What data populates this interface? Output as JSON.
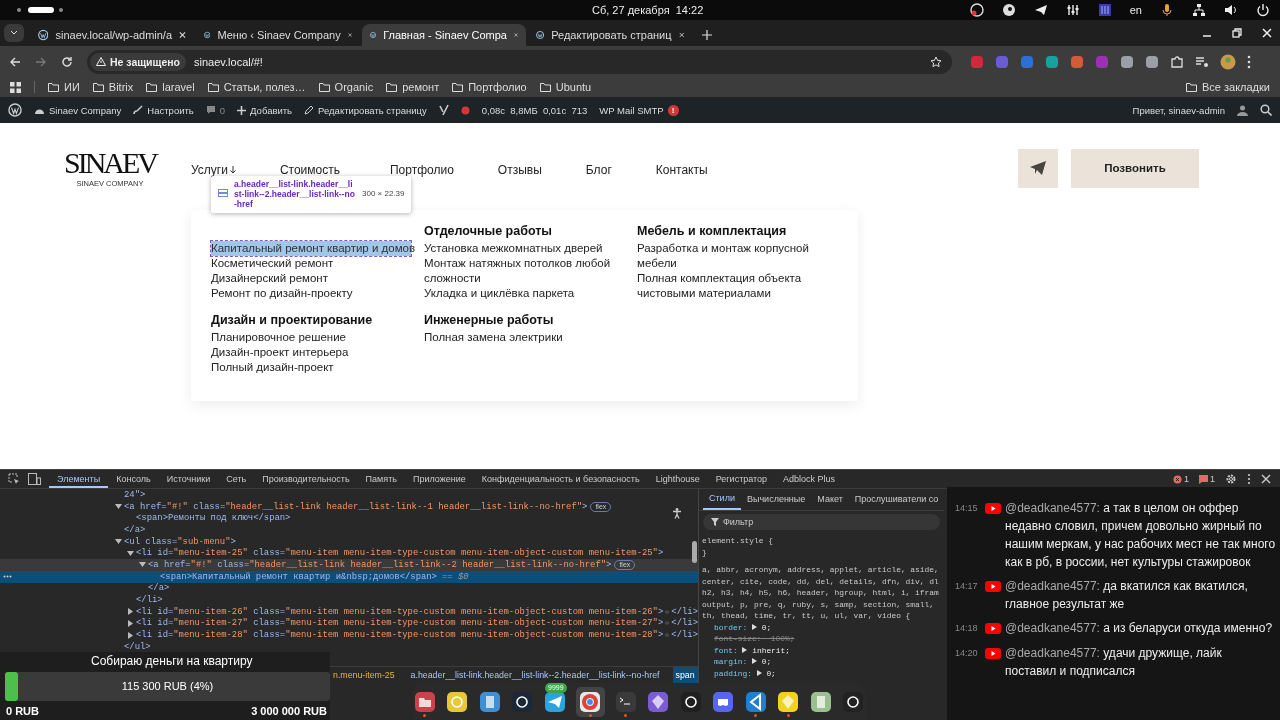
{
  "system_bar": {
    "datetime": "Сб, 27 декабря  14:22",
    "language": "en"
  },
  "browser": {
    "tabs": [
      {
        "title": "sinaev.local/wp-admin/a",
        "selected": false
      },
      {
        "title": "Меню ‹ Sinaev Company",
        "selected": false
      },
      {
        "title": "Главная - Sinaev Compa",
        "selected": true
      },
      {
        "title": "Редактировать страниц",
        "selected": false
      }
    ],
    "security_label": "Не защищено",
    "url": "sinaev.local/#!",
    "bookmarks": [
      "ИИ",
      "Bitrix",
      "laravel",
      "Статьи, полез…",
      "Organic",
      "ремонт",
      "Портфолио",
      "Ubuntu"
    ],
    "all_bookmarks": "Все закладки"
  },
  "admin_bar": {
    "site": "Sinaev Company",
    "customize": "Настроить",
    "comments": "0",
    "add": "Добавить",
    "edit": "Редактировать страницу",
    "stats": "0,08с  8,8МБ  0,01с  713",
    "smtp": "WP Mail SMTP",
    "smtp_alert": "!",
    "greeting": "Привет, sinaev-admin"
  },
  "site": {
    "logo": "SINAEV",
    "logo_caption": "SINAEV COMPANY",
    "nav": [
      {
        "label": "Услуги",
        "dropdown": true
      },
      {
        "label": "Стоимость",
        "dropdown": false
      },
      {
        "label": "Портфолио",
        "dropdown": false
      },
      {
        "label": "Отзывы",
        "dropdown": false
      },
      {
        "label": "Блог",
        "dropdown": false
      },
      {
        "label": "Контакты",
        "dropdown": false
      }
    ],
    "call_button": "Позвонить",
    "mega_menu": [
      {
        "items": [
          {
            "label": "Капитальный ремонт квартир и домов",
            "highlighted": true
          },
          {
            "label": "Косметический ремонт",
            "highlighted": false
          },
          {
            "label": "Дизайнерский ремонт",
            "highlighted": false
          },
          {
            "label": "Ремонт по дизайн-проекту",
            "highlighted": false
          }
        ]
      },
      {
        "title": "Отделочные работы",
        "items": [
          {
            "label": "Установка межкомнатных дверей",
            "highlighted": false
          },
          {
            "label": "Монтаж натяжных потолков любой сложности",
            "highlighted": false
          },
          {
            "label": "Укладка и циклёвка паркета",
            "highlighted": false
          }
        ]
      },
      {
        "title": "Мебель и комплектация",
        "items": [
          {
            "label": "Разработка и монтаж корпусной мебели",
            "highlighted": false
          },
          {
            "label": "Полная комплектация объекта чистовыми материалами",
            "highlighted": false
          }
        ]
      },
      {
        "title": "Дизайн и проектирование",
        "items": [
          {
            "label": "Планировочное решение",
            "highlighted": false
          },
          {
            "label": "Дизайн-проект интерьера",
            "highlighted": false
          },
          {
            "label": "Полный дизайн-проект",
            "highlighted": false
          }
        ]
      },
      {
        "title": "Инженерные работы",
        "items": [
          {
            "label": "Полная замена электрики",
            "highlighted": false
          }
        ]
      }
    ],
    "inspector_tooltip": {
      "selector": "a.header__list-link.header__list-link--2.header__list-link--no-href",
      "size": "300 × 22.39"
    }
  },
  "devtools": {
    "tabs": [
      {
        "label": "Элементы",
        "selected": true
      },
      {
        "label": "Консоль",
        "selected": false
      },
      {
        "label": "Источники",
        "selected": false
      },
      {
        "label": "Сеть",
        "selected": false
      },
      {
        "label": "Производительность",
        "selected": false
      },
      {
        "label": "Память",
        "selected": false
      },
      {
        "label": "Приложение",
        "selected": false
      },
      {
        "label": "Конфиденциальность и безопасность",
        "selected": false
      },
      {
        "label": "Lighthouse",
        "selected": false
      },
      {
        "label": "Регистратор",
        "selected": false
      },
      {
        "label": "Adblock Plus",
        "selected": false
      }
    ],
    "errors": "1",
    "issues": "1",
    "tree": [
      {
        "text": "24\">",
        "selected": false,
        "hovered": false
      },
      {
        "text": "<a href=\"#!\" class=\"header__list-link header__list-link--1 header__list-link--no-href\">",
        "badge": "flex",
        "expanded": true,
        "selected": false,
        "hovered": false,
        "close": "</a>",
        "children": [
          {
            "text": "<span>Ремонты под ключ</span>",
            "selected": false,
            "hovered": false
          }
        ]
      },
      {
        "text": "<ul class=\"sub-menu\">",
        "expanded": true,
        "selected": false,
        "hovered": false,
        "close": "</ul>",
        "children": [
          {
            "text": "<li id=\"menu-item-25\" class=\"menu-item menu-item-type-custom menu-item-object-custom menu-item-25\">",
            "expanded": true,
            "selected": false,
            "hovered": false,
            "close": "</li>",
            "children": [
              {
                "text": "<a href=\"#!\" class=\"header__list-link header__list-link--2 header__list-link--no-href\">",
                "badge": "flex",
                "expanded": true,
                "selected": false,
                "hovered": true,
                "close": "</a>",
                "children": [
                  {
                    "text": "<span>Капитальный ремонт квартир и&nbsp;домов</span>",
                    "suffix": "== $0",
                    "selected": true,
                    "hovered": false
                  }
                ]
              }
            ]
          },
          {
            "text": "<li id=\"menu-item-26\" class=\"menu-item menu-item-type-custom menu-item-object-custom menu-item-26\">",
            "expanded": false,
            "selected": false,
            "hovered": false,
            "close": "</li>"
          },
          {
            "text": "<li id=\"menu-item-27\" class=\"menu-item menu-item-type-custom menu-item-object-custom menu-item-27\">",
            "expanded": false,
            "selected": false,
            "hovered": false,
            "close": "</li>"
          },
          {
            "text": "<li id=\"menu-item-28\" class=\"menu-item menu-item-type-custom menu-item-object-custom menu-item-28\">",
            "expanded": false,
            "selected": false,
            "hovered": false,
            "close": "</li>"
          }
        ]
      }
    ],
    "breadcrumbs": [
      {
        "label": "n.menu-item-25",
        "selected": false
      },
      {
        "label": "a.header__list-link.header__list-link--2.header__list-link--no-href",
        "selected": false
      },
      {
        "label": "span",
        "selected": true
      }
    ],
    "styles_tabs": [
      {
        "label": "Стили",
        "selected": true
      },
      {
        "label": "Вычисленные",
        "selected": false
      },
      {
        "label": "Макет",
        "selected": false
      },
      {
        "label": "Прослушиватели со",
        "selected": false
      }
    ],
    "filter_placeholder": "Фильтр",
    "styles": [
      {
        "kind": "selector",
        "text": "element.style {"
      },
      {
        "kind": "brace",
        "text": "}"
      },
      {
        "kind": "selector",
        "text": "a, abbr, acronym, address, applet, article, aside,"
      },
      {
        "kind": "selector",
        "text": "center, cite, code, dd, del, details, dfn, div, dl"
      },
      {
        "kind": "selector",
        "text": "h2, h3, h4, h5, h6, header, hgroup, html, i, ifram"
      },
      {
        "kind": "selector",
        "text": "output, p, pre, q, ruby, s, samp, section, small,"
      },
      {
        "kind": "selector",
        "text": "th, thead, time, tr, tt, u, ul, var, video {"
      },
      {
        "kind": "property",
        "name": "border:",
        "value": "0;",
        "expandable": true,
        "overridden": false
      },
      {
        "kind": "property",
        "name": "font-size:",
        "value": "100%;",
        "expandable": false,
        "overridden": true
      },
      {
        "kind": "property",
        "name": "font:",
        "value": "inherit;",
        "expandable": true,
        "overridden": false
      },
      {
        "kind": "property",
        "name": "margin:",
        "value": "0;",
        "expandable": true,
        "overridden": false
      },
      {
        "kind": "property",
        "name": "padding:",
        "value": "0;",
        "expandable": true,
        "overridden": false
      }
    ]
  },
  "donation": {
    "title": "Собираю деньги на квартиру",
    "amount": "115 300 RUB (4%)",
    "level": 0.04,
    "min": "0 RUB",
    "max": "3 000 000 RUB"
  },
  "chat": [
    {
      "time": "14:15",
      "author": "@deadkane4577:",
      "text": "а так в целом он оффер недавно словил, причем довольно жирный по нашим меркам, у нас рабочих мест не так много как в рб, в россии, нет культуры стажировок"
    },
    {
      "time": "14:17",
      "author": "@deadkane4577:",
      "text": "да вкатился как вкатился, главное результат же"
    },
    {
      "time": "14:18",
      "author": "@deadkane4577:",
      "text": "а из беларуси откуда именно?"
    },
    {
      "time": "14:20",
      "author": "@deadkane4577:",
      "text": "удачи дружище, лайк поставил и подписался"
    }
  ],
  "dock": [
    {
      "kind": "files",
      "running": true,
      "focused": false
    },
    {
      "kind": "player",
      "running": false,
      "focused": false
    },
    {
      "kind": "editor",
      "running": false,
      "focused": false
    },
    {
      "kind": "steam",
      "running": false,
      "focused": false
    },
    {
      "kind": "telegram",
      "running": false,
      "focused": false,
      "badge": "9999"
    },
    {
      "kind": "chrome",
      "running": true,
      "focused": true
    },
    {
      "kind": "terminal",
      "running": true,
      "focused": false
    },
    {
      "kind": "obsidian",
      "running": false,
      "focused": false
    },
    {
      "kind": "obs",
      "running": false,
      "focused": false
    },
    {
      "kind": "discord",
      "running": false,
      "focused": false
    },
    {
      "kind": "vscode",
      "running": true,
      "focused": false
    },
    {
      "kind": "bitwarden",
      "running": true,
      "focused": false
    },
    {
      "kind": "trash",
      "running": false,
      "focused": false
    },
    {
      "kind": "ubuntu",
      "running": false,
      "focused": false
    }
  ]
}
